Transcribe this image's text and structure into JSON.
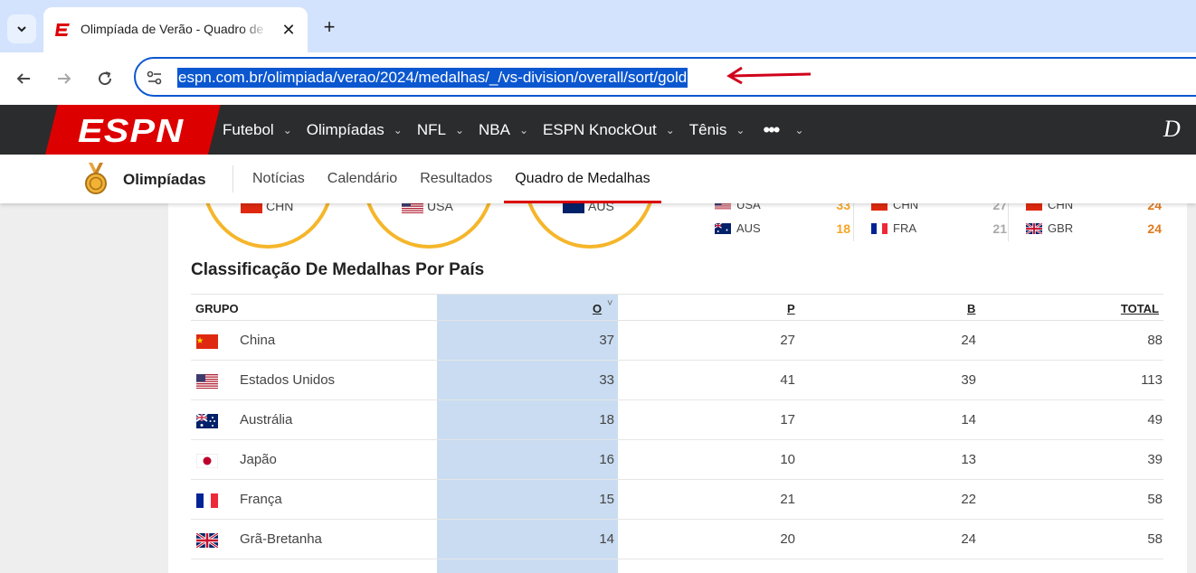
{
  "browser": {
    "tab_title": "Olimpíada de Verão - Quadro de Medalhas",
    "new_tab_symbol": "+",
    "close_symbol": "✕",
    "url": "espn.com.br/olimpiada/verao/2024/medalhas/_/vs-division/overall/sort/gold",
    "accent_color": "#0b57d0",
    "annotation_arrow_color": "#d0021b"
  },
  "espn_nav": {
    "logo": "ESPN",
    "items": [
      {
        "label": "Futebol"
      },
      {
        "label": "Olimpíadas"
      },
      {
        "label": "NFL"
      },
      {
        "label": "NBA"
      },
      {
        "label": "ESPN KnockOut"
      },
      {
        "label": "Tênis"
      }
    ],
    "more_label": "•••"
  },
  "subnav": {
    "title": "Olimpíadas",
    "links": [
      {
        "label": "Notícias"
      },
      {
        "label": "Calendário"
      },
      {
        "label": "Resultados"
      },
      {
        "label": "Quadro de Medalhas",
        "active": true
      }
    ]
  },
  "top_summary": {
    "circles": [
      {
        "code": "CHN"
      },
      {
        "code": "USA"
      },
      {
        "code": "AUS"
      }
    ],
    "mini_columns": [
      {
        "rows": [
          {
            "code": "USA",
            "value": "33"
          },
          {
            "code": "AUS",
            "value": "18"
          }
        ],
        "color": "#f5a623"
      },
      {
        "rows": [
          {
            "code": "CHN",
            "value": "27"
          },
          {
            "code": "FRA",
            "value": "21"
          }
        ],
        "color": "#aaaaaa"
      },
      {
        "rows": [
          {
            "code": "CHN",
            "value": "24"
          },
          {
            "code": "GBR",
            "value": "24"
          }
        ],
        "color": "#e07a1f"
      }
    ]
  },
  "section_title": "Classificação De Medalhas Por País",
  "table": {
    "headers": {
      "group": "GRUPO",
      "gold": "O",
      "silver": "P",
      "bronze": "B",
      "total": "TOTAL"
    },
    "sort_indicator": "˅",
    "rows": [
      {
        "country": "China",
        "flag": "CHN",
        "gold": "37",
        "silver": "27",
        "bronze": "24",
        "total": "88"
      },
      {
        "country": "Estados Unidos",
        "flag": "USA",
        "gold": "33",
        "silver": "41",
        "bronze": "39",
        "total": "113"
      },
      {
        "country": "Austrália",
        "flag": "AUS",
        "gold": "18",
        "silver": "17",
        "bronze": "14",
        "total": "49"
      },
      {
        "country": "Japão",
        "flag": "JPN",
        "gold": "16",
        "silver": "10",
        "bronze": "13",
        "total": "39"
      },
      {
        "country": "França",
        "flag": "FRA",
        "gold": "15",
        "silver": "21",
        "bronze": "22",
        "total": "58"
      },
      {
        "country": "Grã-Bretanha",
        "flag": "GBR",
        "gold": "14",
        "silver": "20",
        "bronze": "24",
        "total": "58"
      }
    ]
  }
}
